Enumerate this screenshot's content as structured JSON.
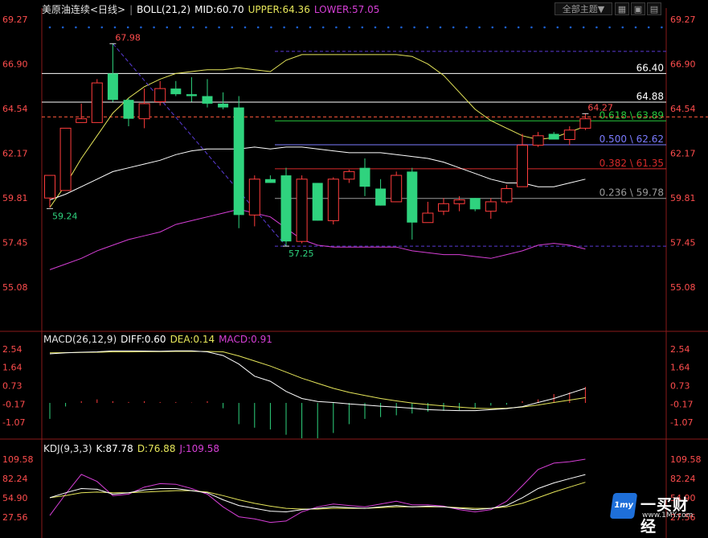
{
  "toolbar": {
    "symbol": "美原油连续",
    "period": "<日线>",
    "indicator_selector": "全部主题",
    "arrow_down": "▼",
    "btn_grid": "▦",
    "btn_zoom": "▣",
    "btn_list": "▤"
  },
  "boll_header": {
    "name": "BOLL(21,2)",
    "mid": "MID:60.70",
    "upper": "UPPER:64.36",
    "lower": "LOWER:57.05"
  },
  "macd_header": {
    "name": "MACD(26,12,9)",
    "diff": "DIFF:0.60",
    "dea": "DEA:0.14",
    "macd": "MACD:0.91"
  },
  "kdj_header": {
    "name": "KDJ(9,3,3)",
    "k": "K:87.78",
    "d": "D:76.88",
    "j": "J:109.58"
  },
  "colors": {
    "up": "#ff3c3c",
    "down": "#2fd37e",
    "upper_band": "#e6e65a",
    "mid_band": "#ffffff",
    "lower_band": "#d63fd6",
    "axis_label": "#ff4d4d",
    "grid_dot": "#1c5fd0"
  },
  "logo": {
    "mark": "1my",
    "text": "一买财经",
    "url": "www.1MY.com"
  },
  "chart_data": [
    {
      "type": "candlestick",
      "panel": "price",
      "yticks": [
        "69.27",
        "66.90",
        "64.54",
        "62.17",
        "59.81",
        "57.45",
        "55.08"
      ],
      "ylim": [
        55.08,
        69.27
      ],
      "ohlc": [
        [
          59.8,
          61.0,
          59.3,
          61.0
        ],
        [
          60.2,
          63.5,
          60.2,
          63.5
        ],
        [
          63.8,
          64.8,
          64.0,
          64.0
        ],
        [
          63.8,
          66.1,
          63.8,
          65.9
        ],
        [
          66.4,
          67.98,
          64.9,
          65.0
        ],
        [
          65.0,
          65.1,
          63.6,
          64.0
        ],
        [
          64.0,
          65.6,
          63.5,
          64.8
        ],
        [
          64.9,
          66.0,
          64.7,
          65.6
        ],
        [
          65.6,
          66.0,
          65.2,
          65.3
        ],
        [
          65.3,
          66.2,
          64.9,
          65.2
        ],
        [
          65.2,
          66.1,
          64.6,
          64.8
        ],
        [
          64.8,
          65.4,
          64.5,
          64.6
        ],
        [
          64.6,
          65.2,
          58.2,
          58.9
        ],
        [
          58.9,
          61.0,
          58.3,
          60.8
        ],
        [
          60.8,
          61.0,
          60.6,
          60.6
        ],
        [
          61.0,
          61.4,
          57.25,
          57.5
        ],
        [
          57.5,
          61.0,
          57.4,
          60.8
        ],
        [
          60.6,
          60.6,
          58.6,
          58.6
        ],
        [
          58.6,
          60.9,
          58.4,
          60.8
        ],
        [
          60.8,
          61.3,
          60.6,
          61.2
        ],
        [
          61.4,
          61.9,
          59.9,
          60.4
        ],
        [
          60.3,
          60.8,
          59.4,
          59.4
        ],
        [
          59.6,
          61.2,
          59.6,
          61.0
        ],
        [
          61.2,
          61.4,
          57.6,
          58.5
        ],
        [
          58.5,
          59.6,
          58.6,
          59.0
        ],
        [
          59.1,
          59.8,
          58.9,
          59.5
        ],
        [
          59.5,
          59.9,
          59.1,
          59.7
        ],
        [
          59.8,
          59.8,
          59.1,
          59.2
        ],
        [
          59.1,
          59.8,
          58.7,
          59.6
        ],
        [
          59.6,
          60.5,
          59.5,
          60.3
        ],
        [
          60.4,
          63.2,
          60.4,
          62.6
        ],
        [
          62.6,
          63.3,
          62.5,
          63.1
        ],
        [
          63.2,
          63.3,
          62.9,
          62.9
        ],
        [
          62.9,
          63.6,
          62.6,
          63.4
        ],
        [
          63.5,
          64.27,
          63.4,
          64.0
        ]
      ],
      "upper": [
        59.3,
        60.5,
        61.9,
        63.1,
        64.3,
        65.1,
        65.7,
        66.1,
        66.4,
        66.5,
        66.6,
        66.6,
        66.7,
        66.6,
        66.5,
        67.1,
        67.4,
        67.4,
        67.4,
        67.4,
        67.4,
        67.4,
        67.4,
        67.3,
        66.9,
        66.3,
        65.4,
        64.5,
        63.9,
        63.5,
        63.1,
        62.9,
        63.0,
        63.3,
        63.6
      ],
      "mid": [
        59.7,
        60.0,
        60.4,
        60.8,
        61.2,
        61.4,
        61.6,
        61.8,
        62.1,
        62.3,
        62.4,
        62.4,
        62.4,
        62.5,
        62.4,
        62.5,
        62.5,
        62.4,
        62.3,
        62.2,
        62.2,
        62.2,
        62.1,
        62.0,
        61.9,
        61.7,
        61.4,
        61.1,
        60.8,
        60.6,
        60.6,
        60.4,
        60.4,
        60.6,
        60.8
      ],
      "lower": [
        56.0,
        56.3,
        56.6,
        57.0,
        57.3,
        57.6,
        57.8,
        58.0,
        58.4,
        58.6,
        58.8,
        59.0,
        59.2,
        59.0,
        58.8,
        58.2,
        57.6,
        57.3,
        57.2,
        57.2,
        57.2,
        57.2,
        57.2,
        57.0,
        56.9,
        56.8,
        56.8,
        56.7,
        56.6,
        56.8,
        57.0,
        57.3,
        57.4,
        57.3,
        57.1
      ],
      "hlines": [
        {
          "value": 66.4,
          "label": "66.40",
          "color": "#ffffff",
          "dashed": false
        },
        {
          "value": 64.88,
          "label": "64.88",
          "color": "#ffffff",
          "dashed": false
        },
        {
          "value": 63.89,
          "label": "0.618 \\ 63.89",
          "color": "#27c83d",
          "dashed": false
        },
        {
          "value": 62.62,
          "label": "0.500 \\ 62.62",
          "color": "#7b7bff",
          "dashed": false
        },
        {
          "value": 61.35,
          "label": "0.382 \\ 61.35",
          "color": "#d62a2a",
          "dashed": false
        },
        {
          "value": 59.78,
          "label": "0.236 \\ 59.78",
          "color": "#9a9a9a",
          "dashed": false
        },
        {
          "value": 67.57,
          "label": "",
          "color": "#5a3bd6",
          "dashed": true
        },
        {
          "value": 57.25,
          "label": "",
          "color": "#5a3bd6",
          "dashed": true
        },
        {
          "value": 64.1,
          "label": "",
          "color": "#ff5a3c",
          "dashed": true
        }
      ],
      "annotations": [
        {
          "index": 4,
          "value": 67.98,
          "label": "67.98",
          "color": "#ff4d4d",
          "pos": "high"
        },
        {
          "index": 0,
          "value": 59.24,
          "label": "59.24",
          "color": "#2fd37e",
          "pos": "low"
        },
        {
          "index": 15,
          "value": 57.25,
          "label": "57.25",
          "color": "#2fd37e",
          "pos": "low"
        },
        {
          "index": 34,
          "value": 64.27,
          "label": "64.27",
          "color": "#ff4d4d",
          "pos": "high"
        }
      ],
      "trendline": {
        "from": [
          4,
          67.98
        ],
        "to": [
          15,
          57.25
        ],
        "color": "#5a3bd6"
      }
    },
    {
      "type": "bar",
      "panel": "macd",
      "yticks": [
        "2.54",
        "1.64",
        "0.73",
        "-0.17",
        "-1.07"
      ],
      "ylim": [
        -1.07,
        2.54
      ],
      "diff": [
        2.3,
        2.35,
        2.38,
        2.4,
        2.45,
        2.45,
        2.44,
        2.43,
        2.45,
        2.45,
        2.4,
        2.22,
        1.8,
        1.2,
        0.95,
        0.45,
        0.1,
        -0.05,
        -0.1,
        -0.17,
        -0.22,
        -0.28,
        -0.33,
        -0.38,
        -0.45,
        -0.48,
        -0.5,
        -0.5,
        -0.45,
        -0.4,
        -0.3,
        -0.1,
        0.1,
        0.35,
        0.6
      ],
      "dea": [
        2.35,
        2.36,
        2.37,
        2.38,
        2.4,
        2.4,
        2.41,
        2.41,
        2.42,
        2.42,
        2.42,
        2.4,
        2.2,
        1.95,
        1.7,
        1.4,
        1.1,
        0.85,
        0.6,
        0.4,
        0.25,
        0.1,
        -0.02,
        -0.12,
        -0.2,
        -0.27,
        -0.33,
        -0.38,
        -0.4,
        -0.38,
        -0.32,
        -0.22,
        -0.1,
        0.02,
        0.14
      ],
      "macd": [
        -0.9,
        -0.2,
        0.1,
        0.2,
        0.1,
        0.05,
        0.1,
        0.05,
        0.05,
        0.02,
        0.1,
        -0.3,
        -1.2,
        -1.4,
        -1.5,
        -1.8,
        -2.0,
        -2.0,
        -1.7,
        -1.2,
        -0.9,
        -0.8,
        -0.7,
        -0.6,
        -0.5,
        -0.45,
        -0.4,
        -0.3,
        -0.15,
        -0.1,
        0.1,
        0.2,
        0.5,
        0.6,
        0.91
      ]
    },
    {
      "type": "line",
      "panel": "kdj",
      "yticks": [
        "109.58",
        "82.24",
        "54.90",
        "27.56"
      ],
      "ylim": [
        27.56,
        109.58
      ],
      "k": [
        55,
        62,
        68,
        67,
        60,
        62,
        66,
        68,
        68,
        65,
        62,
        52,
        44,
        40,
        36,
        35,
        38,
        40,
        42,
        41,
        40,
        42,
        44,
        42,
        43,
        42,
        40,
        38,
        40,
        44,
        55,
        68,
        76,
        82,
        87.78
      ],
      "d": [
        55,
        58,
        62,
        63,
        62,
        62,
        63,
        64,
        65,
        65,
        63,
        58,
        52,
        47,
        43,
        40,
        39,
        39,
        40,
        40,
        40,
        41,
        42,
        42,
        42,
        42,
        41,
        40,
        40,
        42,
        47,
        55,
        63,
        70,
        76.88
      ],
      "j": [
        30,
        60,
        88,
        78,
        58,
        60,
        70,
        75,
        74,
        68,
        60,
        42,
        28,
        25,
        20,
        22,
        35,
        42,
        46,
        44,
        42,
        46,
        50,
        45,
        45,
        43,
        38,
        35,
        38,
        50,
        72,
        95,
        104,
        106,
        109.58
      ]
    }
  ]
}
